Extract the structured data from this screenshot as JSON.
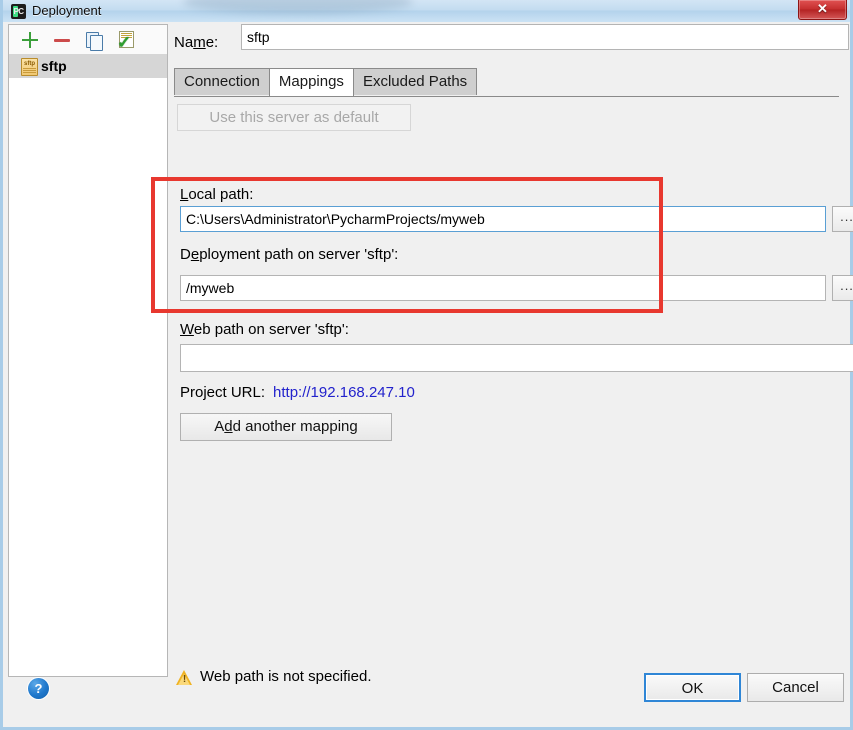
{
  "window": {
    "title": "Deployment",
    "title_icon": "pycharm-icon",
    "close_label": "✕"
  },
  "sidebar": {
    "toolbar": [
      {
        "name": "add-server-button",
        "icon": "plus-icon",
        "label": "+"
      },
      {
        "name": "remove-server-button",
        "icon": "minus-icon",
        "label": "−"
      },
      {
        "name": "copy-server-button",
        "icon": "copy-icon",
        "label": ""
      },
      {
        "name": "use-as-default-button",
        "icon": "check-document-icon",
        "label": ""
      }
    ],
    "servers": [
      {
        "name": "sftp",
        "icon": "sftp-file-icon",
        "selected": true
      }
    ]
  },
  "form": {
    "name_label_pre": "Na",
    "name_label_mn": "m",
    "name_label_post": "e:",
    "name_value": "sftp",
    "name_placeholder": ""
  },
  "tabs": [
    {
      "label": "Connection",
      "selected": false
    },
    {
      "label": "Mappings",
      "selected": true
    },
    {
      "label": "Excluded Paths",
      "selected": false
    }
  ],
  "mappings": {
    "use_default_button": "Use this server as default",
    "local_path": {
      "label": "Local path:",
      "value": "C:\\Users\\Administrator\\PycharmProjects/myweb",
      "placeholder": "",
      "browse_label": "..."
    },
    "deployment_path": {
      "label_pre": "D",
      "label_mn": "e",
      "label_post": "ployment path on server 'sftp':",
      "label": "Deployment path on server 'sftp':",
      "value": "/myweb",
      "placeholder": "",
      "browse_label": "..."
    },
    "web_path": {
      "label_mn": "W",
      "label_post": "eb path on server 'sftp':",
      "label": "Web path on server 'sftp':",
      "value": "",
      "placeholder": ""
    },
    "project_url_label": "Project URL:",
    "project_url_value": "http://192.168.247.10",
    "add_mapping_pre": "A",
    "add_mapping_mn": "d",
    "add_mapping_post": "d another mapping",
    "add_mapping_label": "Add another mapping"
  },
  "annotation": {
    "type": "red-rectangle-highlight",
    "color": "#e8382f"
  },
  "status": {
    "warning_icon": "warning-triangle-icon",
    "warning_text": "Web path is not specified."
  },
  "footer": {
    "help_label": "?",
    "ok_label": "OK",
    "cancel_label": "Cancel"
  },
  "colors": {
    "accent": "#2f86d6",
    "link": "#2222cc",
    "warning": "#f0b323",
    "annotation": "#e8382f",
    "titlebar": "#c3dcf0",
    "panel_bg": "#f0f0f0"
  }
}
